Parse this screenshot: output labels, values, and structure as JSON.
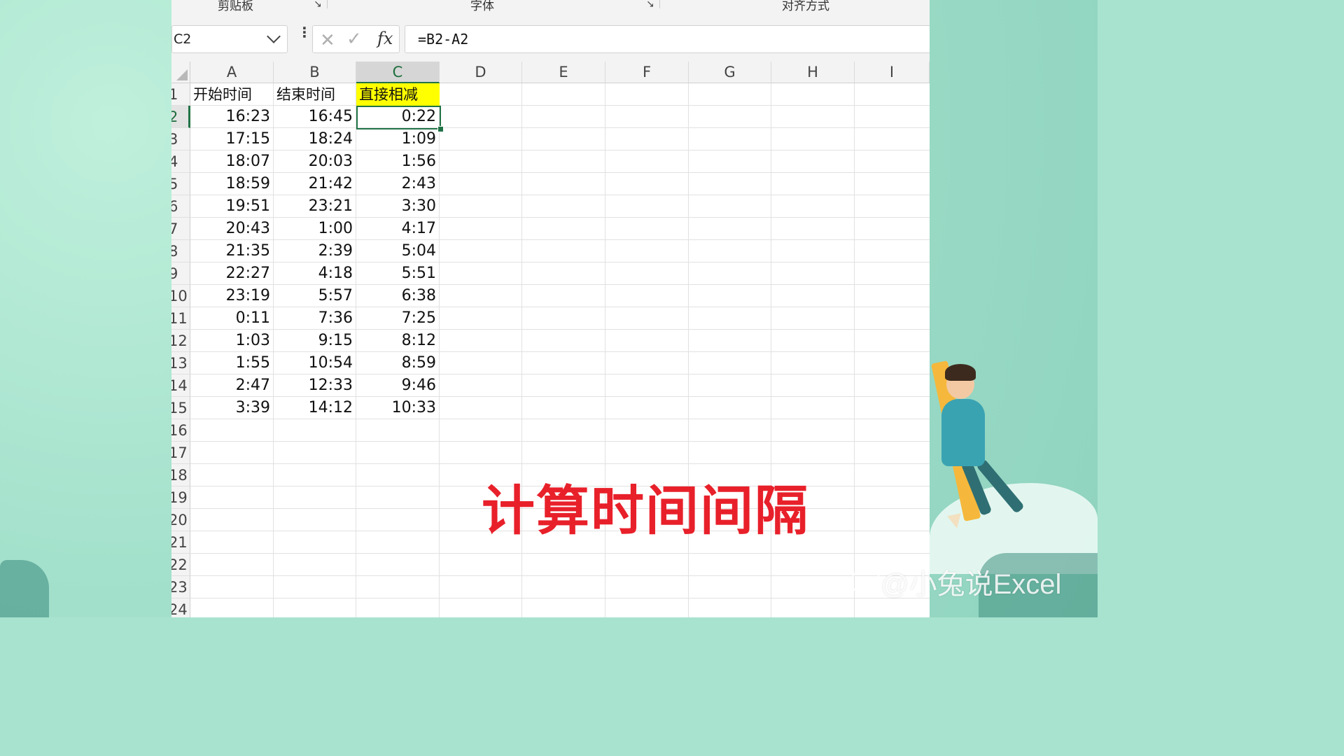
{
  "ribbon": {
    "groups": [
      "剪贴板",
      "字体",
      "对齐方式"
    ]
  },
  "formula_bar": {
    "name_box": "C2",
    "formula": "=B2-A2",
    "fx_label": "fx"
  },
  "sheet": {
    "columns": [
      "A",
      "B",
      "C",
      "D",
      "E",
      "F",
      "G",
      "H",
      "I"
    ],
    "selected_column": "C",
    "row_numbers": [
      "1",
      "2",
      "3",
      "4",
      "5",
      "6",
      "7",
      "8",
      "9",
      "10",
      "11",
      "12",
      "13",
      "14",
      "15",
      "16",
      "17",
      "18",
      "19",
      "20",
      "21",
      "22",
      "23",
      "24"
    ],
    "headers": [
      "开始时间",
      "结束时间",
      "直接相减"
    ],
    "rows": [
      [
        "16:23",
        "16:45",
        "0:22"
      ],
      [
        "17:15",
        "18:24",
        "1:09"
      ],
      [
        "18:07",
        "20:03",
        "1:56"
      ],
      [
        "18:59",
        "21:42",
        "2:43"
      ],
      [
        "19:51",
        "23:21",
        "3:30"
      ],
      [
        "20:43",
        "1:00",
        "4:17"
      ],
      [
        "21:35",
        "2:39",
        "5:04"
      ],
      [
        "22:27",
        "4:18",
        "5:51"
      ],
      [
        "23:19",
        "5:57",
        "6:38"
      ],
      [
        "0:11",
        "7:36",
        "7:25"
      ],
      [
        "1:03",
        "9:15",
        "8:12"
      ],
      [
        "1:55",
        "10:54",
        "8:59"
      ],
      [
        "2:47",
        "12:33",
        "9:46"
      ],
      [
        "3:39",
        "14:12",
        "10:33"
      ]
    ],
    "highlight_color": "#ffff00",
    "accent_color": "#217346"
  },
  "overlay": {
    "title": "计算时间间隔",
    "title_color": "#e8202a",
    "watermark": "@小兔说Excel",
    "watermark_logo": "du"
  }
}
